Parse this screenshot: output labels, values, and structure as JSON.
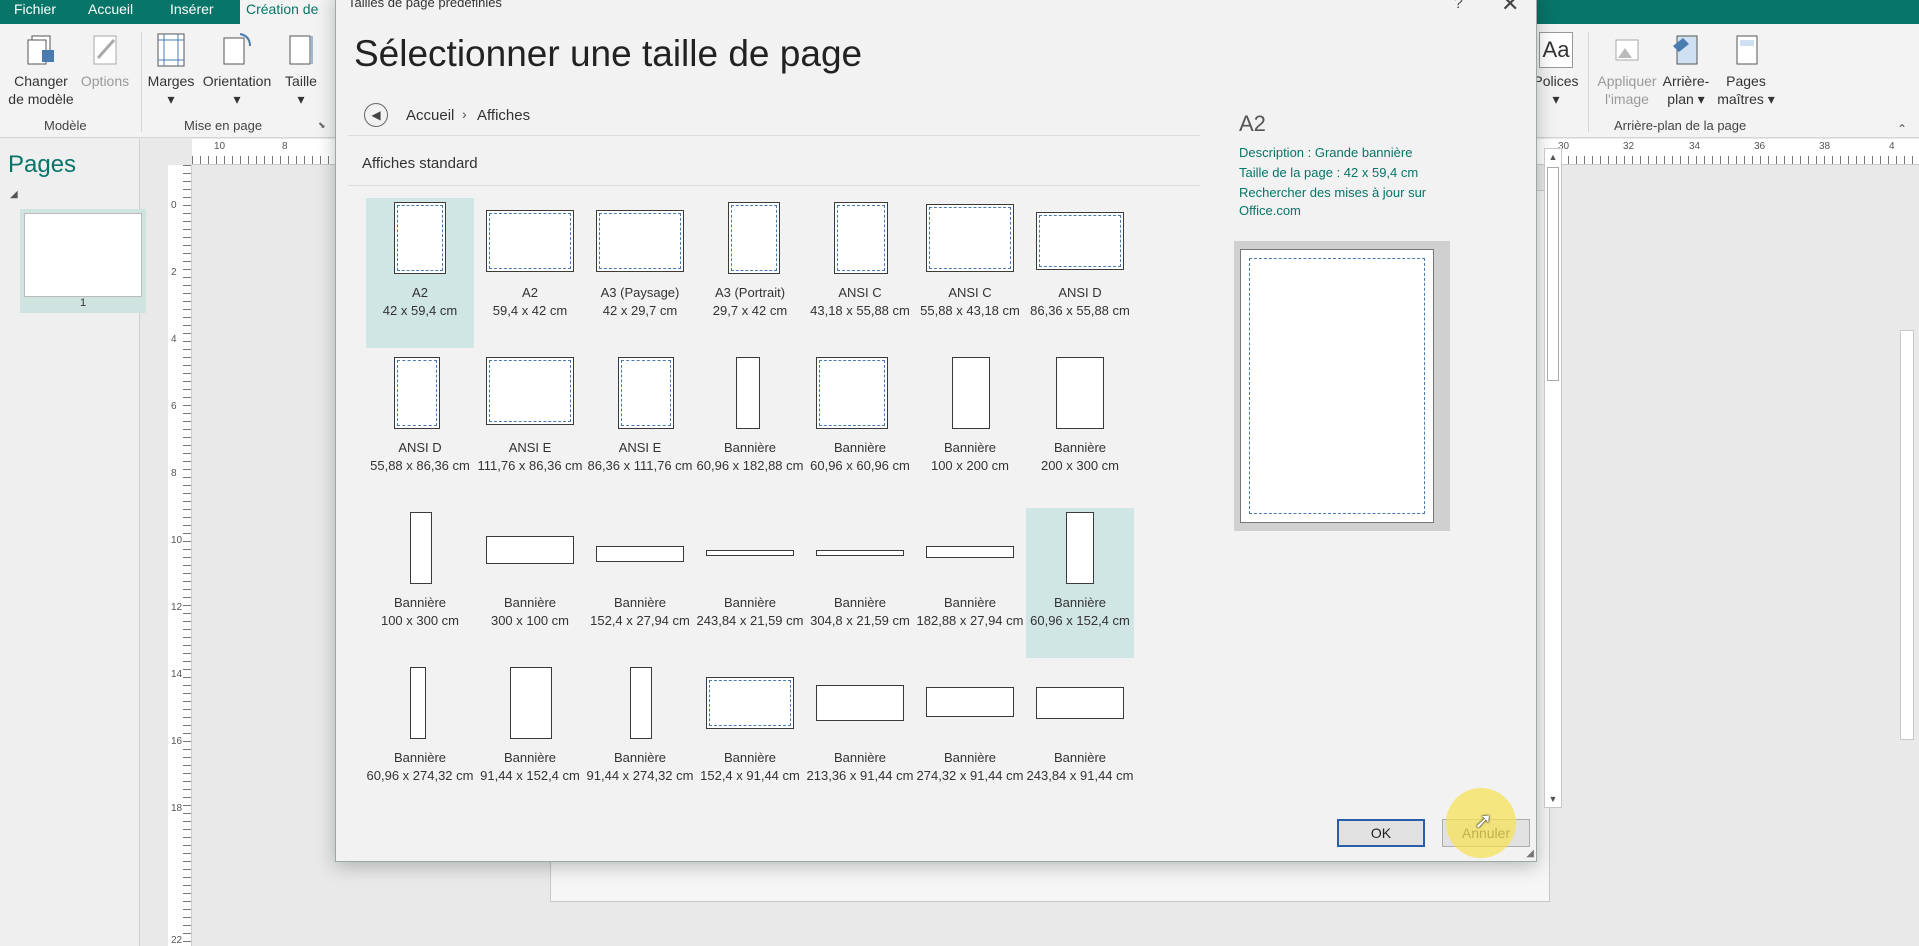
{
  "tabs": [
    "Fichier",
    "Accueil",
    "Insérer",
    "Création de pa"
  ],
  "ribbon": {
    "change_template": "Changer de modèle",
    "options": "Options",
    "margins": "Marges",
    "orientation": "Orientation",
    "size": "Taille",
    "fonts": "Polices",
    "apply_image": "Appliquer l'image",
    "background": "Arrière-plan",
    "master_pages": "Pages maîtres",
    "group_model": "Modèle",
    "group_layout": "Mise en page",
    "group_background": "Arrière-plan de la page",
    "fonts_icon": "Aa"
  },
  "pages_pane": {
    "title": "Pages",
    "page_number": "1"
  },
  "rulers": {
    "h_left": [
      "10",
      "8"
    ],
    "h_right": [
      "30",
      "32",
      "34",
      "36",
      "38",
      "4"
    ],
    "v": [
      "0",
      "2",
      "4",
      "6",
      "8",
      "10",
      "12",
      "14",
      "16",
      "18",
      "22"
    ]
  },
  "dialog": {
    "title": "Tailles de page prédéfinies",
    "help": "?",
    "close": "✕",
    "heading": "Sélectionner une taille de page",
    "breadcrumb_home": "Accueil",
    "breadcrumb_sep": "›",
    "breadcrumb_current": "Affiches",
    "section": "Affiches standard",
    "items": [
      {
        "name": "A2",
        "size": "42 x 59,4 cm",
        "selected": true
      },
      {
        "name": "A2",
        "size": "59,4 x 42 cm"
      },
      {
        "name": "A3 (Paysage)",
        "size": "42 x 29,7 cm"
      },
      {
        "name": "A3 (Portrait)",
        "size": "29,7 x 42 cm"
      },
      {
        "name": "ANSI C",
        "size": "43,18 x 55,88 cm"
      },
      {
        "name": "ANSI C",
        "size": "55,88 x 43,18 cm"
      },
      {
        "name": "ANSI D",
        "size": "86,36 x 55,88 cm"
      },
      {
        "name": "ANSI D",
        "size": "55,88 x 86,36 cm"
      },
      {
        "name": "ANSI E",
        "size": "111,76 x 86,36 cm"
      },
      {
        "name": "ANSI E",
        "size": "86,36 x 111,76 cm"
      },
      {
        "name": "Bannière",
        "size": "60,96 x 182,88 cm"
      },
      {
        "name": "Bannière",
        "size": "60,96 x 60,96 cm"
      },
      {
        "name": "Bannière",
        "size": "100 x 200 cm"
      },
      {
        "name": "Bannière",
        "size": "200 x 300 cm"
      },
      {
        "name": "Bannière",
        "size": "100 x 300 cm"
      },
      {
        "name": "Bannière",
        "size": "300 x 100 cm"
      },
      {
        "name": "Bannière",
        "size": "152,4 x 27,94 cm"
      },
      {
        "name": "Bannière",
        "size": "243,84 x 21,59 cm"
      },
      {
        "name": "Bannière",
        "size": "304,8 x 21,59 cm"
      },
      {
        "name": "Bannière",
        "size": "182,88 x 27,94 cm"
      },
      {
        "name": "Bannière",
        "size": "60,96 x 152,4 cm",
        "hover": true
      },
      {
        "name": "Bannière",
        "size": "60,96 x 274,32 cm"
      },
      {
        "name": "Bannière",
        "size": "91,44 x 152,4 cm"
      },
      {
        "name": "Bannière",
        "size": "91,44 x 274,32 cm"
      },
      {
        "name": "Bannière",
        "size": "152,4 x 91,44 cm"
      },
      {
        "name": "Bannière",
        "size": "213,36 x 91,44 cm"
      },
      {
        "name": "Bannière",
        "size": "274,32 x 91,44 cm"
      },
      {
        "name": "Bannière",
        "size": "243,84 x 91,44 cm"
      }
    ],
    "preview": {
      "name": "A2",
      "description": "Description : Grande bannière",
      "page_size": "Taille de la page : 42 x 59,4 cm",
      "update_line1": "Rechercher des mises à jour sur",
      "update_line2": "Office.com"
    },
    "ok": "OK",
    "cancel": "Annuler"
  },
  "colors": {
    "accent": "#077568",
    "selection": "#cfe6e4",
    "default_button_border": "#2b5ea8"
  }
}
